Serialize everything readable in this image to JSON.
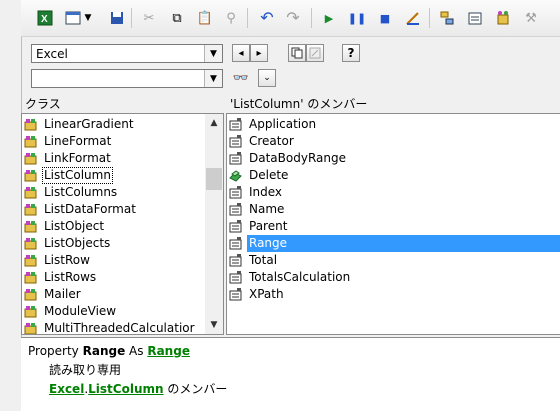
{
  "toolbar": {
    "icons": [
      "excel-view-icon",
      "insert-userform-icon",
      "dropdown-arrow-icon",
      "save-icon",
      "cut-icon",
      "copy-icon",
      "paste-icon",
      "find-icon",
      "undo-icon",
      "redo-icon",
      "run-icon",
      "break-icon",
      "reset-icon",
      "design-mode-icon",
      "project-explorer-icon",
      "properties-window-icon",
      "object-browser-icon",
      "toolbox-icon"
    ]
  },
  "browser": {
    "library_combo": {
      "value": "Excel"
    },
    "search_combo": {
      "value": ""
    },
    "classes_header": "クラス",
    "members_header": "'ListColumn' のメンバー",
    "classes": [
      {
        "label": "LinearGradient",
        "selected": false
      },
      {
        "label": "LineFormat",
        "selected": false
      },
      {
        "label": "LinkFormat",
        "selected": false
      },
      {
        "label": "ListColumn",
        "selected": true
      },
      {
        "label": "ListColumns",
        "selected": false
      },
      {
        "label": "ListDataFormat",
        "selected": false
      },
      {
        "label": "ListObject",
        "selected": false
      },
      {
        "label": "ListObjects",
        "selected": false
      },
      {
        "label": "ListRow",
        "selected": false
      },
      {
        "label": "ListRows",
        "selected": false
      },
      {
        "label": "Mailer",
        "selected": false
      },
      {
        "label": "ModuleView",
        "selected": false
      },
      {
        "label": "MultiThreadedCalculatior",
        "selected": false
      }
    ],
    "members": [
      {
        "label": "Application",
        "kind": "property",
        "selected": false
      },
      {
        "label": "Creator",
        "kind": "property",
        "selected": false
      },
      {
        "label": "DataBodyRange",
        "kind": "property",
        "selected": false
      },
      {
        "label": "Delete",
        "kind": "method",
        "selected": false
      },
      {
        "label": "Index",
        "kind": "property",
        "selected": false
      },
      {
        "label": "Name",
        "kind": "property",
        "selected": false
      },
      {
        "label": "Parent",
        "kind": "property",
        "selected": false
      },
      {
        "label": "Range",
        "kind": "property",
        "selected": true
      },
      {
        "label": "Total",
        "kind": "property",
        "selected": false
      },
      {
        "label": "TotalsCalculation",
        "kind": "property",
        "selected": false
      },
      {
        "label": "XPath",
        "kind": "property",
        "selected": false
      }
    ]
  },
  "detail": {
    "prefix": "Property",
    "name": "Range",
    "as_word": "As",
    "type_link": "Range",
    "readonly": "読み取り専用",
    "library_link": "Excel",
    "dot": ".",
    "class_link": "ListColumn",
    "member_of": "のメンバー"
  },
  "colors": {
    "selection": "#3399ff",
    "link": "#008000"
  }
}
